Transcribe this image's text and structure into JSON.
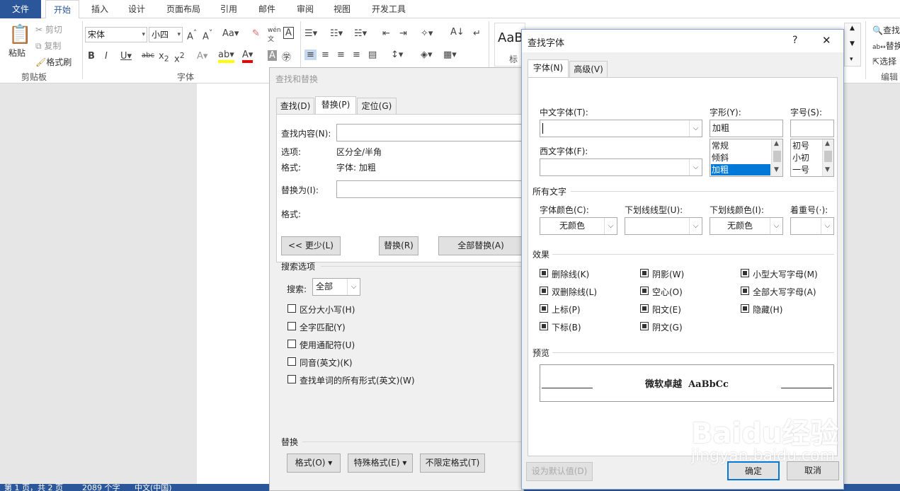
{
  "ribbon": {
    "tabs": [
      "文件",
      "开始",
      "插入",
      "设计",
      "页面布局",
      "引用",
      "邮件",
      "审阅",
      "视图",
      "开发工具"
    ],
    "clipboard": {
      "paste": "粘贴",
      "cut": "剪切",
      "copy": "复制",
      "format_painter": "格式刷",
      "group": "剪贴板"
    },
    "font": {
      "name": "宋体",
      "size": "小四",
      "group": "字体"
    },
    "styles": {
      "preview": "AaB",
      "label": "标"
    },
    "editing": {
      "find": "查找",
      "replace": "替换",
      "select": "选择",
      "group": "编辑"
    }
  },
  "find_replace": {
    "title": "查找和替换",
    "tabs": [
      "查找(D)",
      "替换(P)",
      "定位(G)"
    ],
    "find_label": "查找内容(N):",
    "options_label": "选项:",
    "options_value": "区分全/半角",
    "format_label": "格式:",
    "format_value": "字体: 加粗",
    "replace_label": "替换为(I):",
    "replace_format_label": "格式:",
    "less_button": "<< 更少(L)",
    "replace_button": "替换(R)",
    "replace_all_button": "全部替换(A)",
    "search_options_title": "搜索选项",
    "search_label": "搜索:",
    "search_value": "全部",
    "checkboxes": [
      "区分大小写(H)",
      "全字匹配(Y)",
      "使用通配符(U)",
      "同音(英文)(K)",
      "查找单词的所有形式(英文)(W)"
    ],
    "replace_section": "替换",
    "format_button": "格式(O)",
    "special_button": "特殊格式(E)",
    "noformat_button": "不限定格式(T)"
  },
  "find_font": {
    "title": "查找字体",
    "help": "?",
    "close": "✕",
    "tabs": [
      "字体(N)",
      "高级(V)"
    ],
    "chinese_font_label": "中文字体(T):",
    "chinese_font_value": "",
    "western_font_label": "西文字体(F):",
    "western_font_value": "",
    "style_label": "字形(Y):",
    "style_value": "加粗",
    "style_items": [
      "常规",
      "倾斜",
      "加粗"
    ],
    "size_label": "字号(S):",
    "size_value": "",
    "size_items": [
      "初号",
      "小初",
      "一号"
    ],
    "all_text_title": "所有文字",
    "font_color_label": "字体颜色(C):",
    "font_color_value": "无颜色",
    "underline_label": "下划线线型(U):",
    "underline_value": "",
    "underline_color_label": "下划线颜色(I):",
    "underline_color_value": "无颜色",
    "emphasis_label": "着重号(·):",
    "emphasis_value": "",
    "effects_title": "效果",
    "effects": [
      [
        "删除线(K)",
        "阴影(W)",
        "小型大写字母(M)"
      ],
      [
        "双删除线(L)",
        "空心(O)",
        "全部大写字母(A)"
      ],
      [
        "上标(P)",
        "阳文(E)",
        "隐藏(H)"
      ],
      [
        "下标(B)",
        "阴文(G)",
        ""
      ]
    ],
    "preview_title": "预览",
    "preview_text": "微软卓越  AaBbCc",
    "set_default": "设为默认值(D)",
    "ok": "确定",
    "cancel": "取消"
  },
  "status": {
    "page": "第 1 页，共 2 页",
    "words": "2089 个字",
    "lang": "中文(中国)"
  },
  "watermark": {
    "brand": "Baidu经验",
    "url": "jingyan.baidu.com"
  }
}
